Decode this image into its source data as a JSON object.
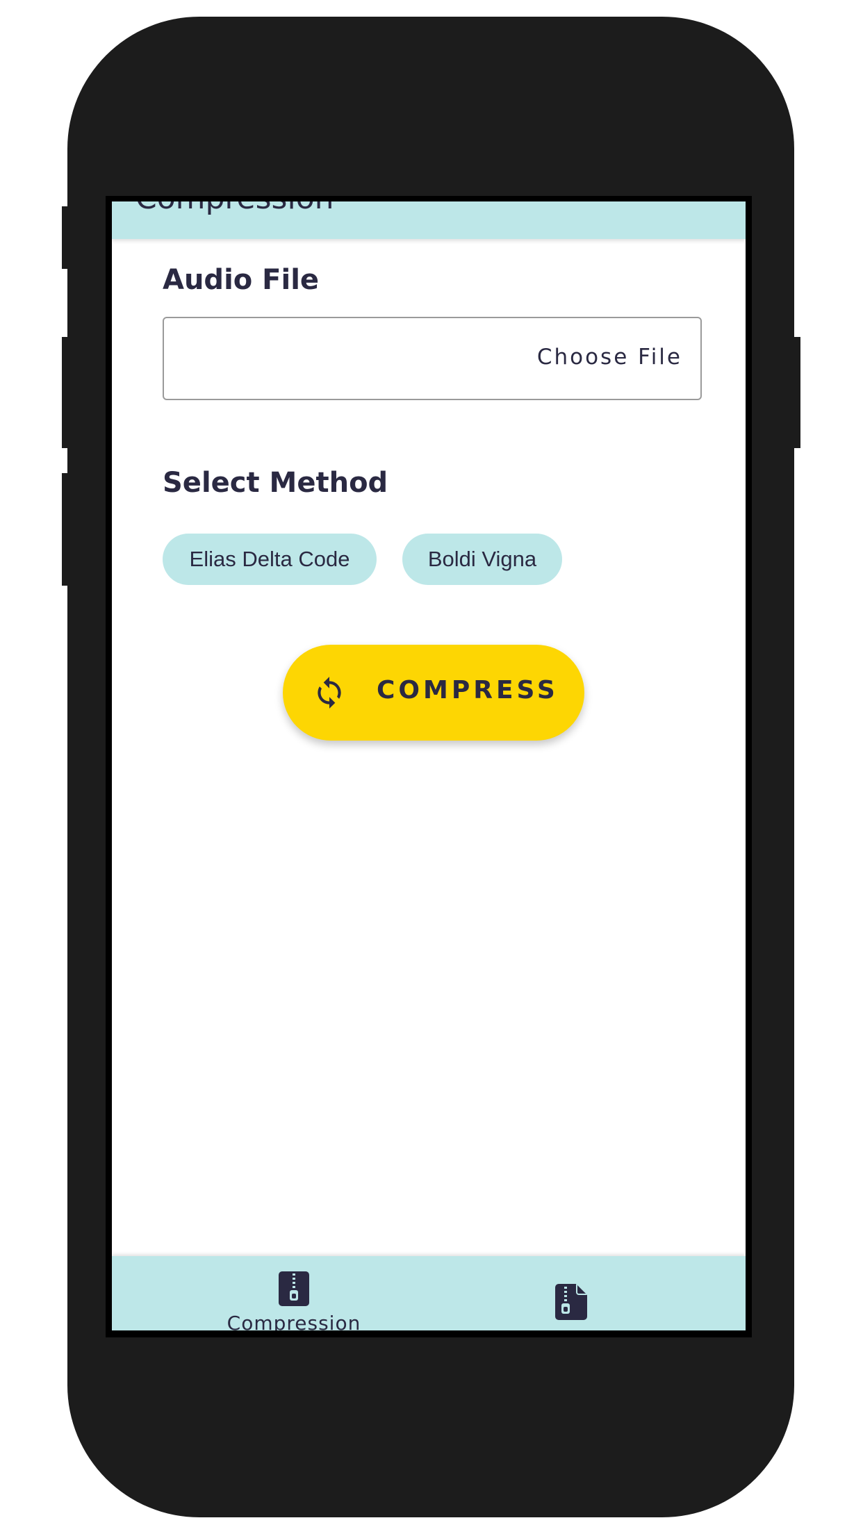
{
  "app_bar": {
    "title": "Compression"
  },
  "form": {
    "audio_file_label": "Audio File",
    "choose_file_label": "Choose File",
    "select_method_label": "Select Method",
    "methods": [
      {
        "label": "Elias Delta Code"
      },
      {
        "label": "Boldi Vigna"
      }
    ]
  },
  "compress_button": {
    "label": "COMPRESS",
    "icon": "refresh-icon"
  },
  "bottom_nav": {
    "items": [
      {
        "label": "Compression",
        "icon": "zip-file-icon"
      },
      {
        "label": "",
        "icon": "zip-document-icon"
      }
    ]
  },
  "colors": {
    "accent": "#bde7e8",
    "primary_button": "#fdd603",
    "text": "#2a2942",
    "device": "#1c1c1c"
  }
}
